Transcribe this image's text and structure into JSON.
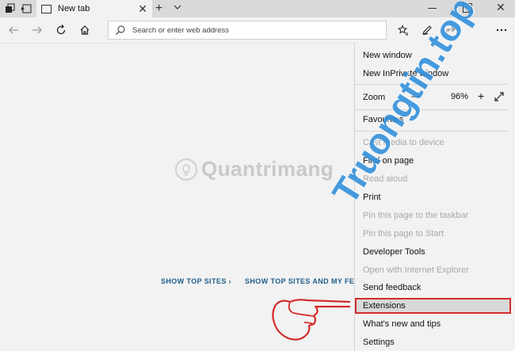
{
  "tabbar": {
    "tab_title": "New tab",
    "new_tab_symbol": "+",
    "close_symbol": "✕"
  },
  "navbar": {
    "address_placeholder": "Search or enter web address"
  },
  "content": {
    "logo_text": "Quantrimang",
    "show_top_sites": "SHOW TOP SITES",
    "show_top_sites_and_feed": "SHOW TOP SITES AND MY FEED"
  },
  "watermark": "Truongtin.top",
  "menu": {
    "new_window": "New window",
    "new_inprivate_window": "New InPrivate window",
    "zoom_label": "Zoom",
    "zoom_out_symbol": "—",
    "zoom_level": "96%",
    "zoom_in_symbol": "+",
    "favourites": "Favourites",
    "cast_media": "Cast media to device",
    "find_on_page": "Find on page",
    "read_aloud": "Read aloud",
    "print": "Print",
    "pin_taskbar": "Pin this page to the taskbar",
    "pin_start": "Pin this page to Start",
    "developer_tools": "Developer Tools",
    "open_with_ie": "Open with Internet Explorer",
    "send_feedback": "Send feedback",
    "extensions": "Extensions",
    "whats_new": "What's new and tips",
    "settings": "Settings"
  },
  "colors": {
    "accent_link": "#20608d",
    "highlight_border": "#d52b2b",
    "watermark": "#2f8fdb"
  }
}
